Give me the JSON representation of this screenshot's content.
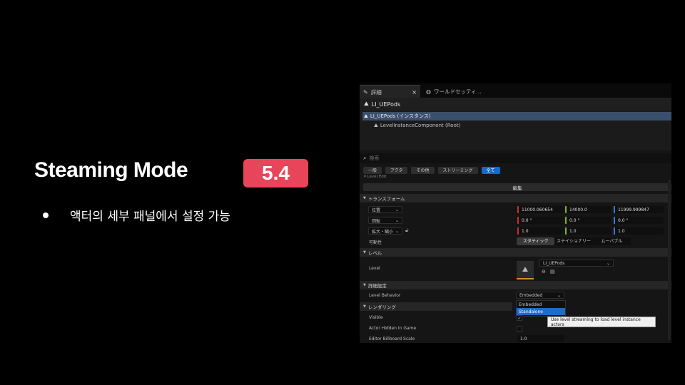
{
  "slide": {
    "title": "Steaming Mode",
    "version_badge": "5.4",
    "bullet": "액터의 세부 패널에서 설정 가능"
  },
  "editor": {
    "tabs": [
      {
        "label": "詳細",
        "icon": "pencil-icon",
        "close": "×"
      },
      {
        "label": "ワールドセッティ...",
        "icon": "globe-icon"
      }
    ],
    "header_title": "LI_UEPods",
    "tree": {
      "selected": "LI_UEPods (インスタンス)",
      "child": "LevelInstanceComponent (Root)"
    },
    "search_placeholder": "検索",
    "filters": [
      "一般",
      "アクタ",
      "その他",
      "ストリーミング",
      "全て"
    ],
    "active_filter": "全て",
    "cut_section": "Level Edit",
    "edit_button": "編集",
    "transform": {
      "section": "トランスフォーム",
      "location_label": "位置",
      "rotation_label": "回転",
      "scale_label": "拡大・縮小",
      "location": [
        "11000.060654",
        "14000.0",
        "11999.999847"
      ],
      "rotation": [
        "0.0 °",
        "0.0 °",
        "0.0 °"
      ],
      "scale": [
        "1.0",
        "1.0",
        "1.0"
      ],
      "mobility_label": "可動性",
      "mobility_options": [
        "スタティック",
        "ステイショナリー",
        "ムーバブル"
      ],
      "mobility_selected": "スタティック"
    },
    "level": {
      "section": "レベル",
      "label": "Level",
      "asset": "LI_UEPods"
    },
    "details": {
      "section": "詳細設定",
      "behavior_label": "Level Behavior",
      "behavior_value": "Embedded",
      "menu_options": [
        "Embedded",
        "Standalone"
      ],
      "menu_highlight": "Standalone"
    },
    "rendering": {
      "section": "レンダリング",
      "visible_label": "Visible",
      "hidden_label": "Actor Hidden In Game",
      "billboard_label": "Editor Billboard Scale",
      "billboard_value": "1.0"
    },
    "tooltip": "Use level streaming to load level instance actors",
    "colors": {
      "accent": "#0f6bd1",
      "badge": "#e9455a",
      "selection": "#3a4f6c"
    }
  }
}
